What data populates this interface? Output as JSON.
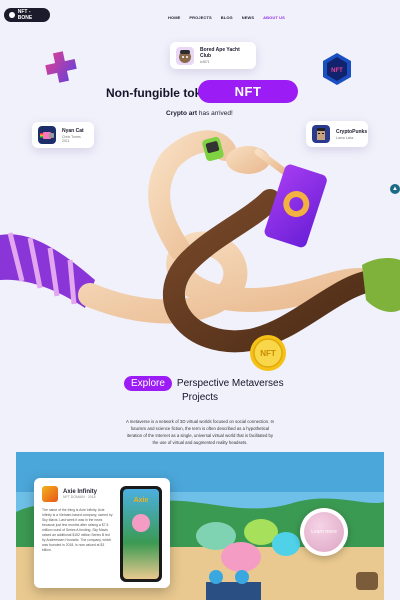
{
  "header": {
    "logo_text": "NFT - BONE",
    "nav": [
      {
        "label": "HOME",
        "active": false
      },
      {
        "label": "PROJECTS",
        "active": false
      },
      {
        "label": "BLOG",
        "active": false
      },
      {
        "label": "NEWS",
        "active": false
      },
      {
        "label": "ABOUT US",
        "active": true
      }
    ]
  },
  "hero": {
    "title": "Non-fungible token",
    "pill": "NFT",
    "subtitle_bold": "Crypto art",
    "subtitle_rest": " has arrived!",
    "cards": [
      {
        "title": "Bored Ape Yacht Club",
        "sub": "#4871",
        "color": "#e9d7f7"
      },
      {
        "title": "Nyan Cat",
        "sub": "Chris Torres 2011",
        "color": "#1c2f6b"
      },
      {
        "title": "CryptoPunks",
        "sub": "Larva Labs",
        "color": "#2a3b8f"
      }
    ],
    "coin_text": "NFT",
    "badge_text": "NFT"
  },
  "explore": {
    "pill": "Explore",
    "heading_rest": "Perspective Metaverses",
    "heading_line2": "Projects",
    "paragraph": "A metaverse is a network of 3D virtual worlds focused on social connection. In futurism and science fiction, the term is often described as a hypothetical iteration of the Internet as a single, universal virtual world that is facilitated by the use of virtual and augmented reality headsets."
  },
  "project_card": {
    "name": "Axie Infinity",
    "meta": "NFT DOMAIN · 2018",
    "description": "The name of the thing is Axie Infinity. Axie Infinity is a Vietnam-based company, owned by Sky Mavis. Last week it was in the news because just few months after raising a $7.5 million round of Series A funding, Sky Mavis raised an additional $152 million Series B led by Andreessen Horowitz. The company, which was founded in 2018, is now valued at $3 billion.",
    "phone_title": "Axie"
  },
  "learn_more": "Learn more",
  "icons": {
    "scroll": "chevron-up-icon",
    "plus": "plus-3d-icon",
    "coin": "nft-coin-icon",
    "badge": "nft-hexagon-icon",
    "donut": "donut-icon"
  },
  "colors": {
    "accent": "#9b1cf5",
    "background": "#f1f1fb",
    "active_nav": "#8e2ce8"
  }
}
